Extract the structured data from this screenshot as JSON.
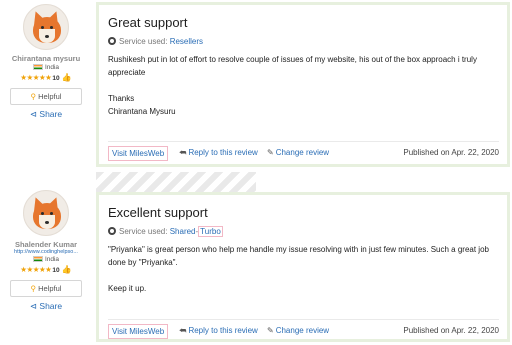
{
  "reviews": [
    {
      "user": {
        "name": "Chirantana mysuru",
        "link": "",
        "country": "India",
        "score": "10",
        "stars": "★★★★★"
      },
      "helpful_label": "Helpful",
      "share_label": "Share",
      "title": "Great support",
      "service_prefix": "Service used:",
      "services": [
        "Resellers"
      ],
      "body": [
        "Rushikesh put in lot of effort to resolve couple of issues of my website, his out of the box approach i truly appreciate",
        "Thanks",
        "Chirantana Mysuru"
      ],
      "footer": {
        "visit_label": "Visit MilesWeb",
        "reply_label": "Reply to this review",
        "change_label": "Change review",
        "published": "Published on Apr. 22, 2020"
      }
    },
    {
      "user": {
        "name": "Shalender Kumar",
        "link": "http://www.codinghelpso...",
        "country": "India",
        "score": "10",
        "stars": "★★★★★"
      },
      "helpful_label": "Helpful",
      "share_label": "Share",
      "title": "Excellent support",
      "service_prefix": "Service used:",
      "services": [
        "Shared",
        "Turbo"
      ],
      "service_separator": "-",
      "body": [
        "\"Priyanka\" is great person who help me handle my issue resolving with in just few minutes. Such a great job done by \"Priyanka\".",
        "Keep it up."
      ],
      "footer": {
        "visit_label": "Visit MilesWeb",
        "reply_label": "Reply to this review",
        "change_label": "Change review",
        "published": "Published on Apr. 22, 2020"
      }
    }
  ],
  "colors": {
    "link": "#2a6db5",
    "card_border": "#e7f0de",
    "star": "#f0a30a",
    "thumb": "#3aa52e",
    "highlight_border": "#f2b8c6"
  },
  "icons": [
    "fox-avatar-icon",
    "india-flag-icon",
    "star-icon",
    "thumbs-up-icon",
    "lightbulb-icon",
    "share-icon",
    "service-icon",
    "reply-icon",
    "edit-icon"
  ]
}
